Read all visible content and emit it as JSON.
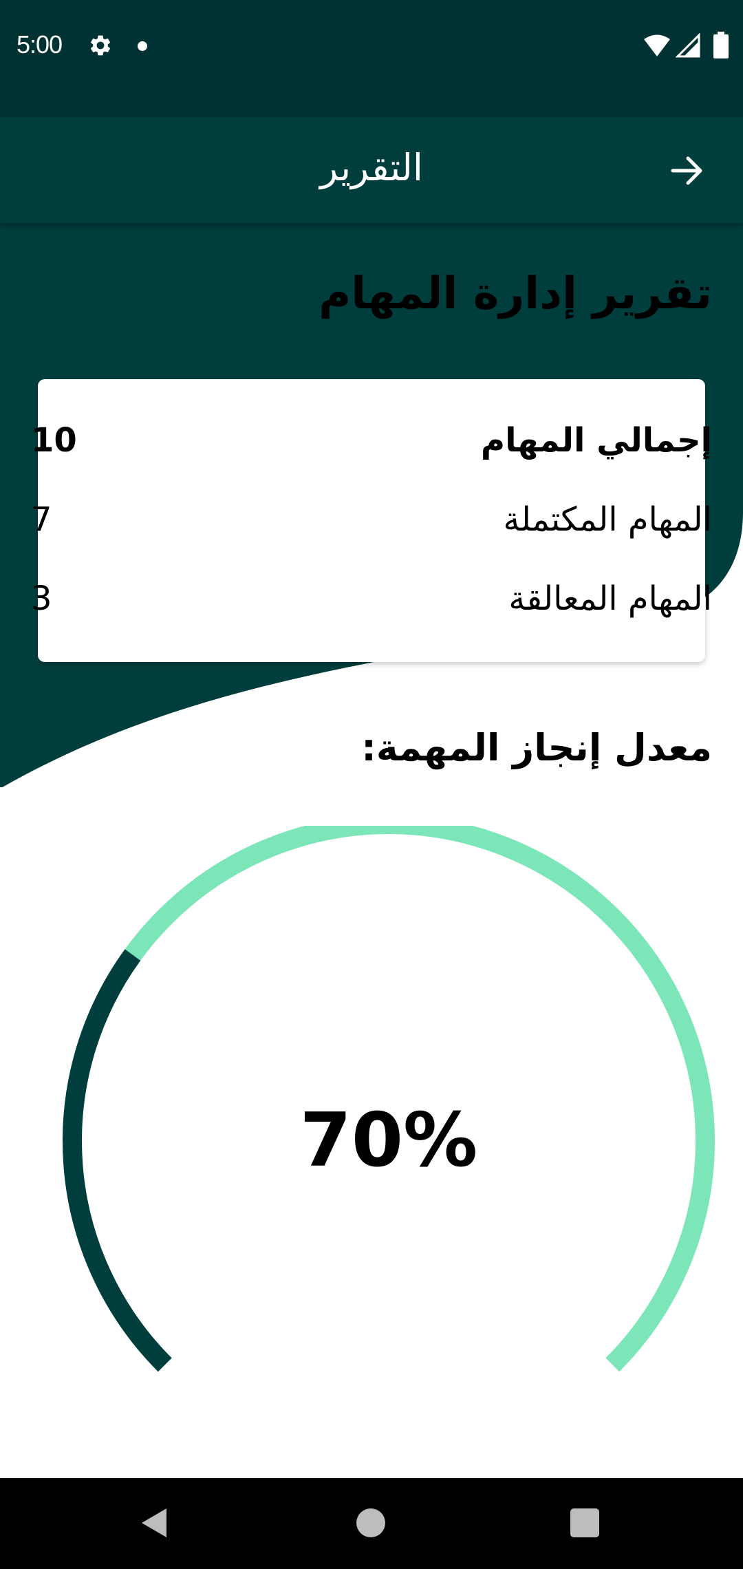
{
  "status_bar": {
    "time": "5:00",
    "icons": [
      "settings-gear-icon",
      "notification-dot-icon",
      "wifi-icon",
      "cell-signal-icon",
      "battery-icon"
    ]
  },
  "app_bar": {
    "title": "التقرير",
    "back_icon": "arrow-right-icon"
  },
  "page": {
    "heading": "تقرير إدارة المهام"
  },
  "stats": {
    "rows": [
      {
        "label": "إجمالي المهام",
        "value": "10"
      },
      {
        "label": "المهام المكتملة",
        "value": "7"
      },
      {
        "label": "المهام المعالقة",
        "value": "3"
      }
    ]
  },
  "completion": {
    "label": "معدل إنجاز المهمة:",
    "value_text": "70%",
    "fraction": 0.7
  },
  "colors": {
    "status_bar": "#003233",
    "app_bar": "#003e3d",
    "accent_dark": "#003e3d",
    "accent_light": "#7ce6b9",
    "nav_bar": "#000000"
  },
  "nav_bar": {
    "icons": [
      "nav-back-icon",
      "nav-home-icon",
      "nav-recents-icon"
    ]
  }
}
